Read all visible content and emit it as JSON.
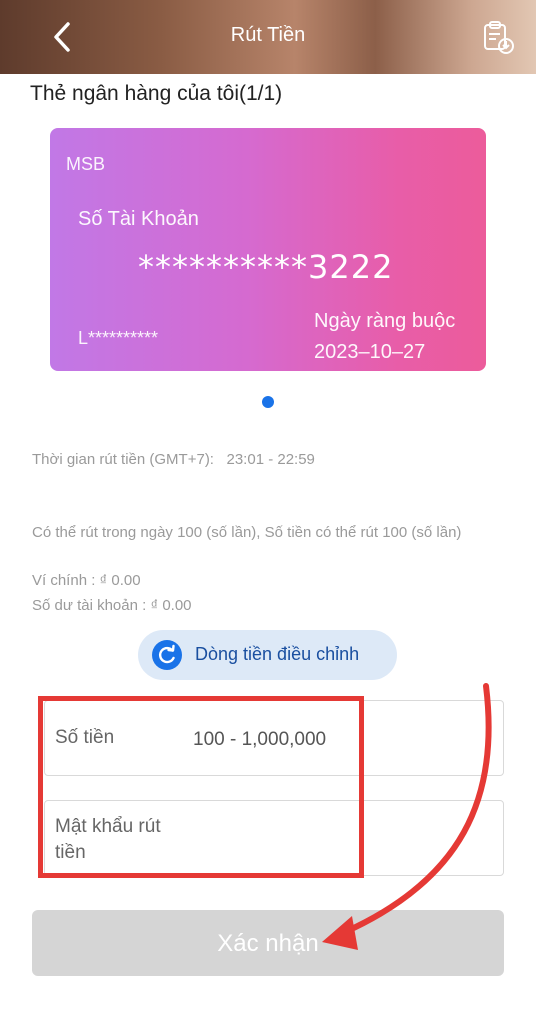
{
  "header": {
    "title": "Rút Tiền",
    "back_icon": "chevron-left-icon",
    "record_icon": "clipboard-download-icon"
  },
  "section": {
    "title": "Thẻ ngân hàng của tôi(1/1)"
  },
  "card": {
    "bank": "MSB",
    "account_label": "Số Tài Khoản",
    "account_number": "**********3222",
    "holder": "L**********",
    "bind_label": "Ngày ràng buộc",
    "bind_date": "2023–10–27"
  },
  "info": {
    "time_label": "Thời gian rút tiền (GMT+7):",
    "time_value": "23:01 - 22:59",
    "limit_text": "Có thể rút trong ngày 100 (số lần), Số tiền có thể rút 100 (số lần)",
    "wallet": "Ví chính : ₫ 0.00",
    "balance": "Số dư tài khoản : ₫ 0.00"
  },
  "adjust": {
    "label": "Dòng tiền điều chỉnh",
    "icon": "refresh-icon"
  },
  "form": {
    "amount_label": "Số tiền",
    "amount_placeholder": "100 - 1,000,000",
    "password_label": "Mật khẩu rút tiền"
  },
  "confirm": {
    "label": "Xác nhận"
  },
  "colors": {
    "accent": "#1a73e8",
    "annotation": "#e53935",
    "disabled_button": "#d5d5d5"
  }
}
